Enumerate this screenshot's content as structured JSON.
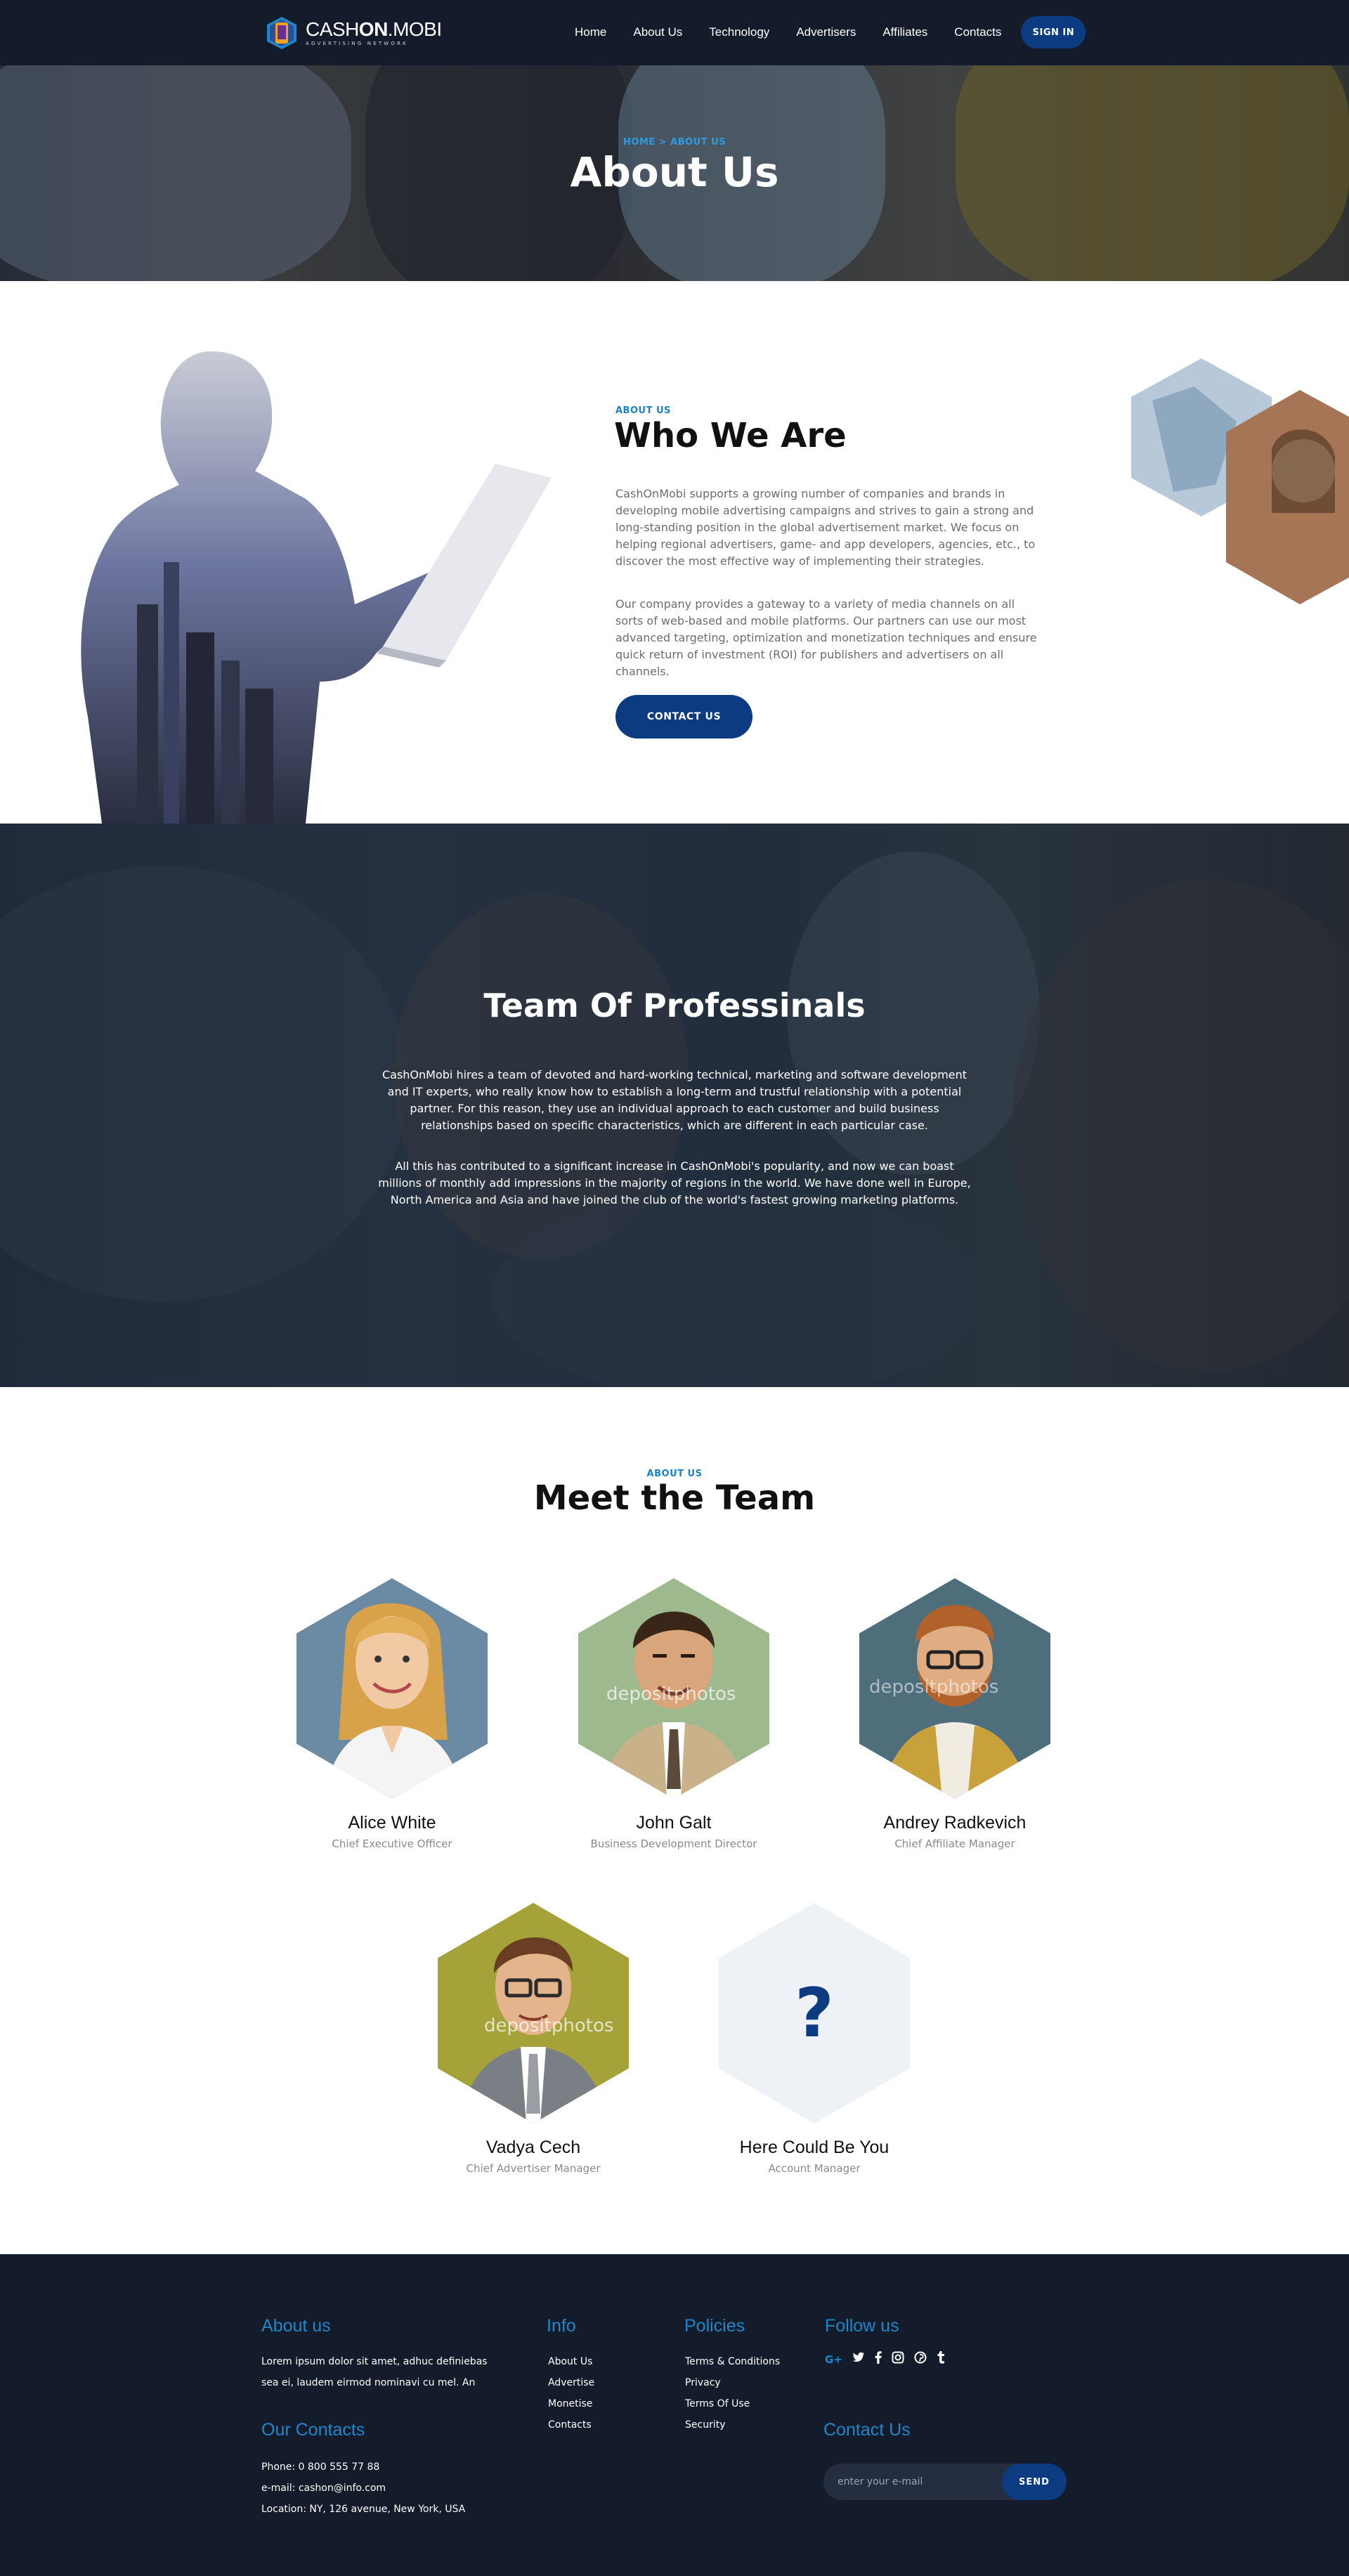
{
  "header": {
    "logo": {
      "main_a": "CASH",
      "main_b": "ON",
      "main_c": ".MOBI",
      "sub": "ADVERTISING NETWORK"
    },
    "nav": [
      "Home",
      "About Us",
      "Technology",
      "Advertisers",
      "Affiliates",
      "Contacts"
    ],
    "signin_label": "SIGN IN"
  },
  "hero": {
    "breadcrumb": "HOME > ABOUT US",
    "title": "About Us"
  },
  "who": {
    "kicker": "ABOUT US",
    "title": "Who We Are",
    "p1": "CashOnMobi supports a growing number of companies and brands in developing mobile advertising campaigns and strives to gain a strong and long-standing position in the global advertisement market. We focus on helping regional advertisers, game- and app developers, agencies, etc., to discover the most effective way of implementing their strategies.",
    "p2": "Our company provides a gateway to a variety of media channels on all sorts of web-based and mobile platforms. Our partners can use our most advanced targeting, optimization and monetization techniques and ensure quick return of investment (ROI) for publishers and advertisers on all channels.",
    "button": "CONTACT US"
  },
  "professionals": {
    "title": "Team Of Professinals",
    "p1": "CashOnMobi hires a team of devoted and hard-working technical, marketing and software development and IT experts, who really know how to establish a long-term and trustful relationship with a potential partner. For this reason, they use an individual approach to each customer and build business relationships based on specific characteristics, which are different in each particular case.",
    "p2": "All this has contributed to a significant increase in CashOnMobi's popularity, and now we can boast millions of monthly add impressions in the majority of regions in the world. We have done well in Europe, North America and Asia and have joined the club of the world's fastest growing marketing platforms."
  },
  "team": {
    "kicker": "ABOUT US",
    "title": "Meet the Team",
    "members": [
      {
        "name": "Alice White",
        "role": "Chief Executive Officer",
        "bg": "#6b8ba4"
      },
      {
        "name": "John Galt",
        "role": "Business Development Director",
        "bg": "#9fb98f"
      },
      {
        "name": "Andrey Radkevich",
        "role": "Chief Affiliate Manager",
        "bg": "#4e6e7c"
      },
      {
        "name": "Vadya Cech",
        "role": "Chief Advertiser Manager",
        "bg": "#a5a23a"
      },
      {
        "name": "Here Could Be You",
        "role": "Account Manager",
        "bg": "#eef2f7"
      }
    ],
    "placeholder_glyph": "?",
    "watermark": "depositphotos"
  },
  "footer": {
    "about": {
      "heading": "About us",
      "text": "Lorem ipsum dolor sit amet, adhuc definiebas sea ei, laudem eirmod nominavi cu mel. An"
    },
    "info": {
      "heading": "Info",
      "links": [
        "About Us",
        "Advertise",
        "Monetise",
        "Contacts"
      ]
    },
    "policies": {
      "heading": "Policies",
      "links": [
        "Terms & Conditions",
        "Privacy",
        "Terms Of Use",
        "Security"
      ]
    },
    "follow": {
      "heading": "Follow us",
      "icons": [
        "google-plus-icon",
        "twitter-icon",
        "facebook-icon",
        "instagram-icon",
        "pinterest-icon",
        "tumblr-icon"
      ]
    },
    "contacts": {
      "heading": "Our Contacts",
      "phone": "Phone: 0 800 555 77 88",
      "email": "e-mail: cashon@info.com",
      "location": "Location: NY, 126 avenue, New York, USA"
    },
    "subscribe": {
      "heading": "Contact Us",
      "placeholder": "enter your e-mail",
      "button": "SEND"
    }
  },
  "colors": {
    "navy": "#141c2c",
    "accent_blue": "#1f86c8",
    "button_blue": "#0d3b82"
  }
}
